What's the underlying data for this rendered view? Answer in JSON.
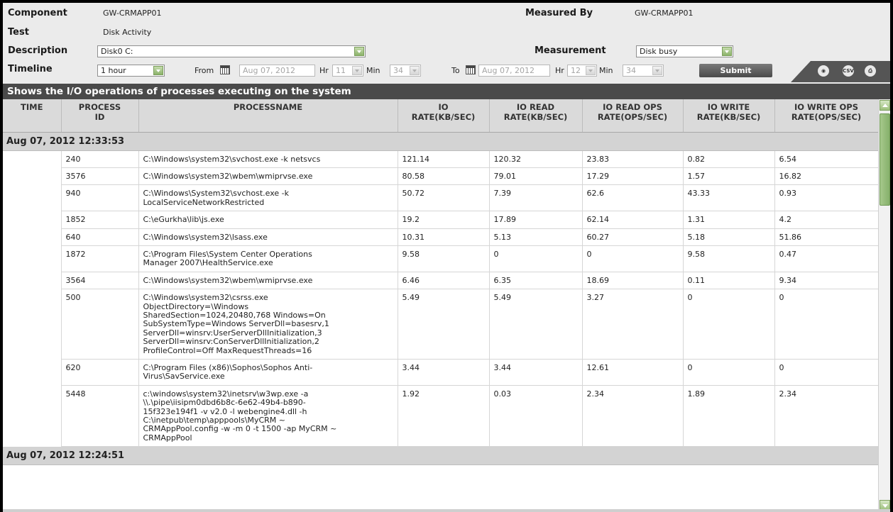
{
  "header": {
    "component_label": "Component",
    "component_value": "GW-CRMAPP01",
    "test_label": "Test",
    "test_value": "Disk Activity",
    "description_label": "Description",
    "description_value": "Disk0 C:",
    "timeline_label": "Timeline",
    "timeline_value": "1 hour",
    "measured_by_label": "Measured By",
    "measured_by_value": "GW-CRMAPP01",
    "measurement_label": "Measurement",
    "measurement_value": "Disk busy",
    "from_label": "From",
    "from_date": "Aug 07, 2012",
    "from_hr_label": "Hr",
    "from_hr": "11",
    "from_min_label": "Min",
    "from_min": "34",
    "to_label": "To",
    "to_date": "Aug 07, 2012",
    "to_hr_label": "Hr",
    "to_hr": "12",
    "to_min_label": "Min",
    "to_min": "34",
    "submit_label": "Submit",
    "csv_label": "CSV"
  },
  "title": "Shows the I/O operations of processes executing on the system",
  "columns": [
    {
      "line1": "TIME",
      "line2": ""
    },
    {
      "line1": "PROCESS",
      "line2": "ID"
    },
    {
      "line1": "PROCESSNAME",
      "line2": ""
    },
    {
      "line1": "IO",
      "line2": "RATE(KB/SEC)"
    },
    {
      "line1": "IO READ",
      "line2": "RATE(KB/SEC)"
    },
    {
      "line1": "IO READ OPS",
      "line2": "RATE(OPS/SEC)"
    },
    {
      "line1": "IO WRITE",
      "line2": "RATE(KB/SEC)"
    },
    {
      "line1": "IO WRITE OPS",
      "line2": "RATE(OPS/SEC)"
    }
  ],
  "groups": [
    {
      "time": "Aug 07, 2012 12:33:53",
      "rows": [
        {
          "pid": "240",
          "name": [
            "C:\\Windows\\system32\\svchost.exe -k netsvcs"
          ],
          "io": "121.14",
          "io_read": "120.32",
          "io_read_ops": "23.83",
          "io_write": "0.82",
          "io_write_ops": "6.54"
        },
        {
          "pid": "3576",
          "name": [
            "C:\\Windows\\system32\\wbem\\wmiprvse.exe"
          ],
          "io": "80.58",
          "io_read": "79.01",
          "io_read_ops": "17.29",
          "io_write": "1.57",
          "io_write_ops": "16.82"
        },
        {
          "pid": "940",
          "name": [
            "C:\\Windows\\System32\\svchost.exe -k",
            "LocalServiceNetworkRestricted"
          ],
          "io": "50.72",
          "io_read": "7.39",
          "io_read_ops": "62.6",
          "io_write": "43.33",
          "io_write_ops": "0.93"
        },
        {
          "pid": "1852",
          "name": [
            "C:\\eGurkha\\lib\\js.exe"
          ],
          "io": "19.2",
          "io_read": "17.89",
          "io_read_ops": "62.14",
          "io_write": "1.31",
          "io_write_ops": "4.2"
        },
        {
          "pid": "640",
          "name": [
            "C:\\Windows\\system32\\lsass.exe"
          ],
          "io": "10.31",
          "io_read": "5.13",
          "io_read_ops": "60.27",
          "io_write": "5.18",
          "io_write_ops": "51.86"
        },
        {
          "pid": "1872",
          "name": [
            "C:\\Program Files\\System Center Operations",
            "Manager 2007\\HealthService.exe"
          ],
          "io": "9.58",
          "io_read": "0",
          "io_read_ops": "0",
          "io_write": "9.58",
          "io_write_ops": "0.47"
        },
        {
          "pid": "3564",
          "name": [
            "C:\\Windows\\system32\\wbem\\wmiprvse.exe"
          ],
          "io": "6.46",
          "io_read": "6.35",
          "io_read_ops": "18.69",
          "io_write": "0.11",
          "io_write_ops": "9.34"
        },
        {
          "pid": "500",
          "name": [
            "C:\\Windows\\system32\\csrss.exe",
            "ObjectDirectory=\\Windows",
            "SharedSection=1024,20480,768 Windows=On",
            "SubSystemType=Windows ServerDll=basesrv,1",
            "ServerDll=winsrv:UserServerDllInitialization,3",
            "ServerDll=winsrv:ConServerDllInitialization,2",
            "ProfileControl=Off MaxRequestThreads=16"
          ],
          "io": "5.49",
          "io_read": "5.49",
          "io_read_ops": "3.27",
          "io_write": "0",
          "io_write_ops": "0"
        },
        {
          "pid": "620",
          "name": [
            "C:\\Program Files (x86)\\Sophos\\Sophos Anti-",
            "Virus\\SavService.exe"
          ],
          "io": "3.44",
          "io_read": "3.44",
          "io_read_ops": "12.61",
          "io_write": "0",
          "io_write_ops": "0"
        },
        {
          "pid": "5448",
          "name": [
            "c:\\windows\\system32\\inetsrv\\w3wp.exe -a",
            "\\\\.\\pipe\\iisipm0dbd6b8c-6e62-49b4-b890-",
            "15f323e194f1 -v v2.0 -l webengine4.dll -h",
            "C:\\inetpub\\temp\\apppools\\MyCRM ~",
            "CRMAppPool.config -w -m 0 -t 1500 -ap MyCRM ~",
            "CRMAppPool"
          ],
          "io": "1.92",
          "io_read": "0.03",
          "io_read_ops": "2.34",
          "io_write": "1.89",
          "io_write_ops": "2.34"
        }
      ]
    },
    {
      "time": "Aug 07, 2012 12:24:51",
      "rows": []
    }
  ]
}
